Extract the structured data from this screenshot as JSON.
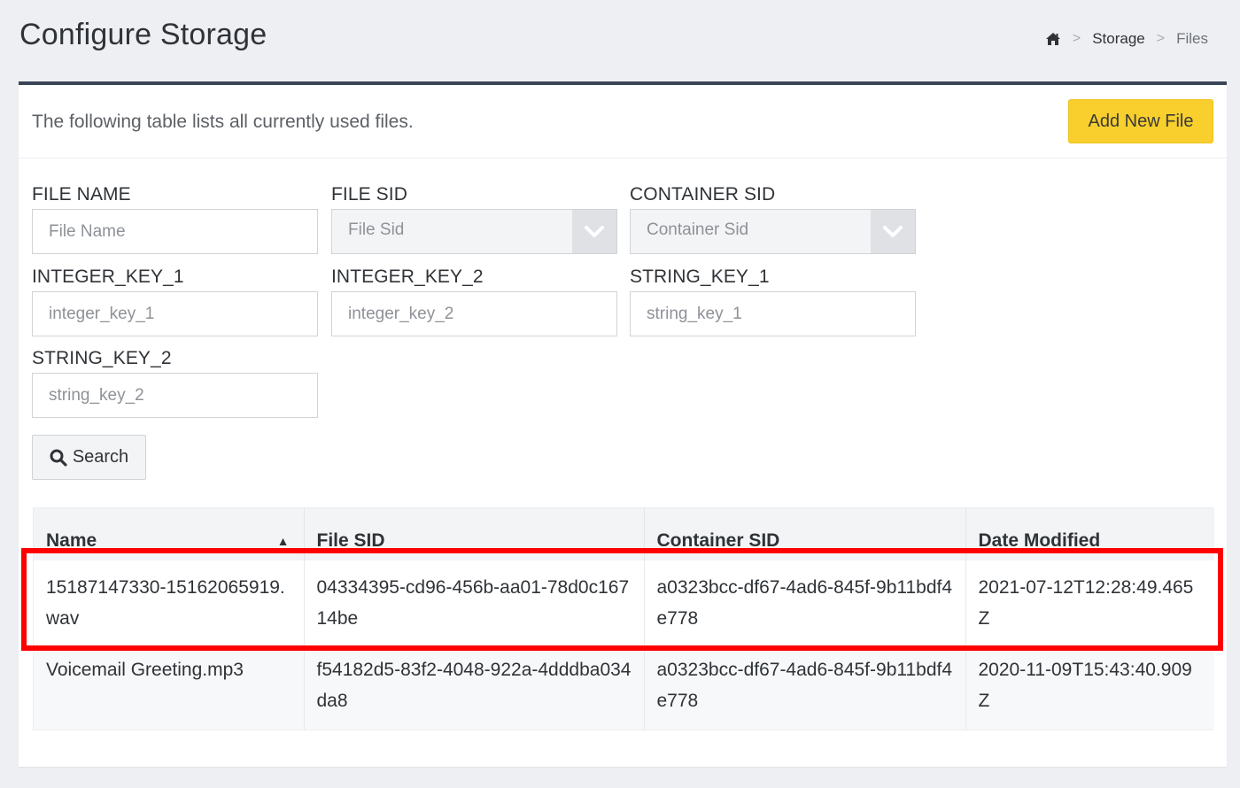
{
  "header": {
    "title": "Configure Storage",
    "breadcrumb": {
      "home_icon": "home-icon",
      "separator": ">",
      "items": [
        "Storage",
        "Files"
      ]
    }
  },
  "card": {
    "intro": "The following table lists all currently used files.",
    "add_button_label": "Add New File",
    "accent_color": "#f8cf2c"
  },
  "filters": {
    "file_name": {
      "label": "FILE NAME",
      "placeholder": "File Name"
    },
    "file_sid": {
      "label": "FILE SID",
      "placeholder": "File Sid"
    },
    "container_sid": {
      "label": "CONTAINER SID",
      "placeholder": "Container Sid"
    },
    "integer_key_1": {
      "label": "INTEGER_KEY_1",
      "placeholder": "integer_key_1"
    },
    "integer_key_2": {
      "label": "INTEGER_KEY_2",
      "placeholder": "integer_key_2"
    },
    "string_key_1": {
      "label": "STRING_KEY_1",
      "placeholder": "string_key_1"
    },
    "string_key_2": {
      "label": "STRING_KEY_2",
      "placeholder": "string_key_2"
    },
    "search_label": "Search"
  },
  "table": {
    "columns": [
      "Name",
      "File SID",
      "Container SID",
      "Date Modified"
    ],
    "sort_column": "Name",
    "sort_direction": "ascending",
    "rows": [
      [
        "15187147330-15162065919.wav",
        "04334395-cd96-456b-aa01-78d0c16714be",
        "a0323bcc-df67-4ad6-845f-9b11bdf4e778",
        "2021-07-12T12:28:49.465Z"
      ],
      [
        "Voicemail Greeting.mp3",
        "f54182d5-83f2-4048-922a-4dddba034da8",
        "a0323bcc-df67-4ad6-845f-9b11bdf4e778",
        "2020-11-09T15:43:40.909Z"
      ]
    ]
  },
  "annotation": {
    "highlighted_row": 1,
    "color": "#ff0000"
  }
}
